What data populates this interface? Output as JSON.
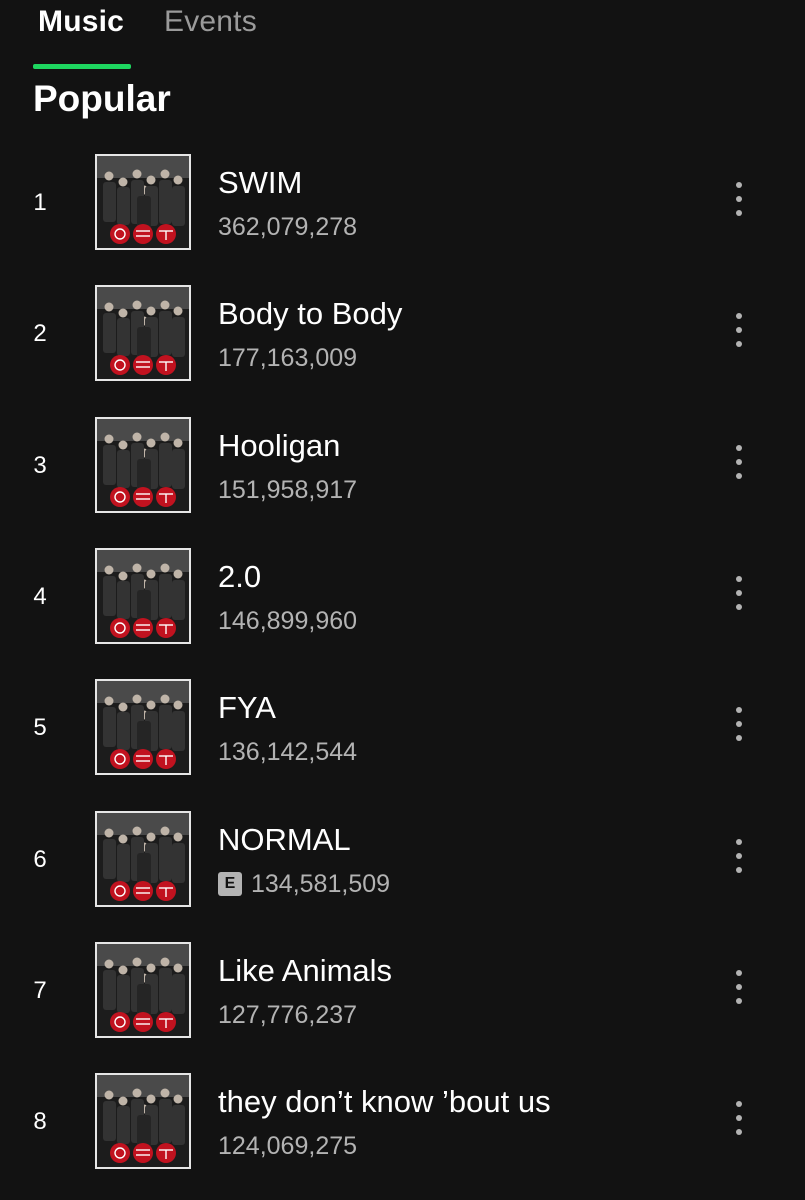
{
  "tabs": [
    {
      "label": "Music",
      "active": true
    },
    {
      "label": "Events",
      "active": false
    }
  ],
  "accent_color": "#1ed760",
  "section_title": "Popular",
  "tracks": [
    {
      "rank": "1",
      "title": "SWIM",
      "plays": "362,079,278",
      "explicit": false
    },
    {
      "rank": "2",
      "title": "Body to Body",
      "plays": "177,163,009",
      "explicit": false
    },
    {
      "rank": "3",
      "title": "Hooligan",
      "plays": "151,958,917",
      "explicit": false
    },
    {
      "rank": "4",
      "title": "2.0",
      "plays": "146,899,960",
      "explicit": false
    },
    {
      "rank": "5",
      "title": "FYA",
      "plays": "136,142,544",
      "explicit": false
    },
    {
      "rank": "6",
      "title": "NORMAL",
      "plays": "134,581,509",
      "explicit": true,
      "explicit_label": "E"
    },
    {
      "rank": "7",
      "title": "Like Animals",
      "plays": "127,776,237",
      "explicit": false
    },
    {
      "rank": "8",
      "title": "they don’t know ’bout us",
      "plays": "124,069,275",
      "explicit": false
    }
  ],
  "icons": {
    "more": "more-vertical-icon",
    "cover": "album-cover-image"
  }
}
